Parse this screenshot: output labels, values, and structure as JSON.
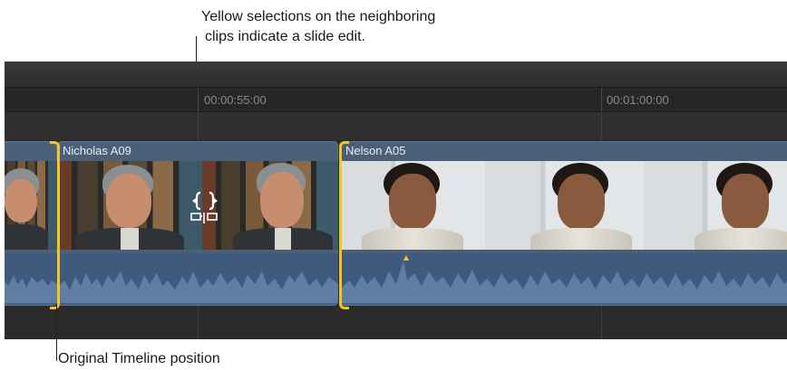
{
  "annotations": {
    "top_line1": "Yellow selections on the neighboring",
    "top_line2": "clips indicate a slide edit.",
    "bottom": "Original Timeline position"
  },
  "ruler": {
    "timecode_1": "00:00:55:00",
    "timecode_2": "00:01:00:00"
  },
  "clips": {
    "left_partial": {
      "title": ""
    },
    "nicholas": {
      "title": "Nicholas A09"
    },
    "nelson": {
      "title": "Nelson A05"
    }
  },
  "colors": {
    "timeline_bg": "#2b2b2b",
    "clip_blue": "#4a5f78",
    "audio_blue": "#3f5a7d",
    "selection_yellow": "#f3c623"
  },
  "icons": {
    "cursor": "slide-edit-cursor-icon"
  }
}
